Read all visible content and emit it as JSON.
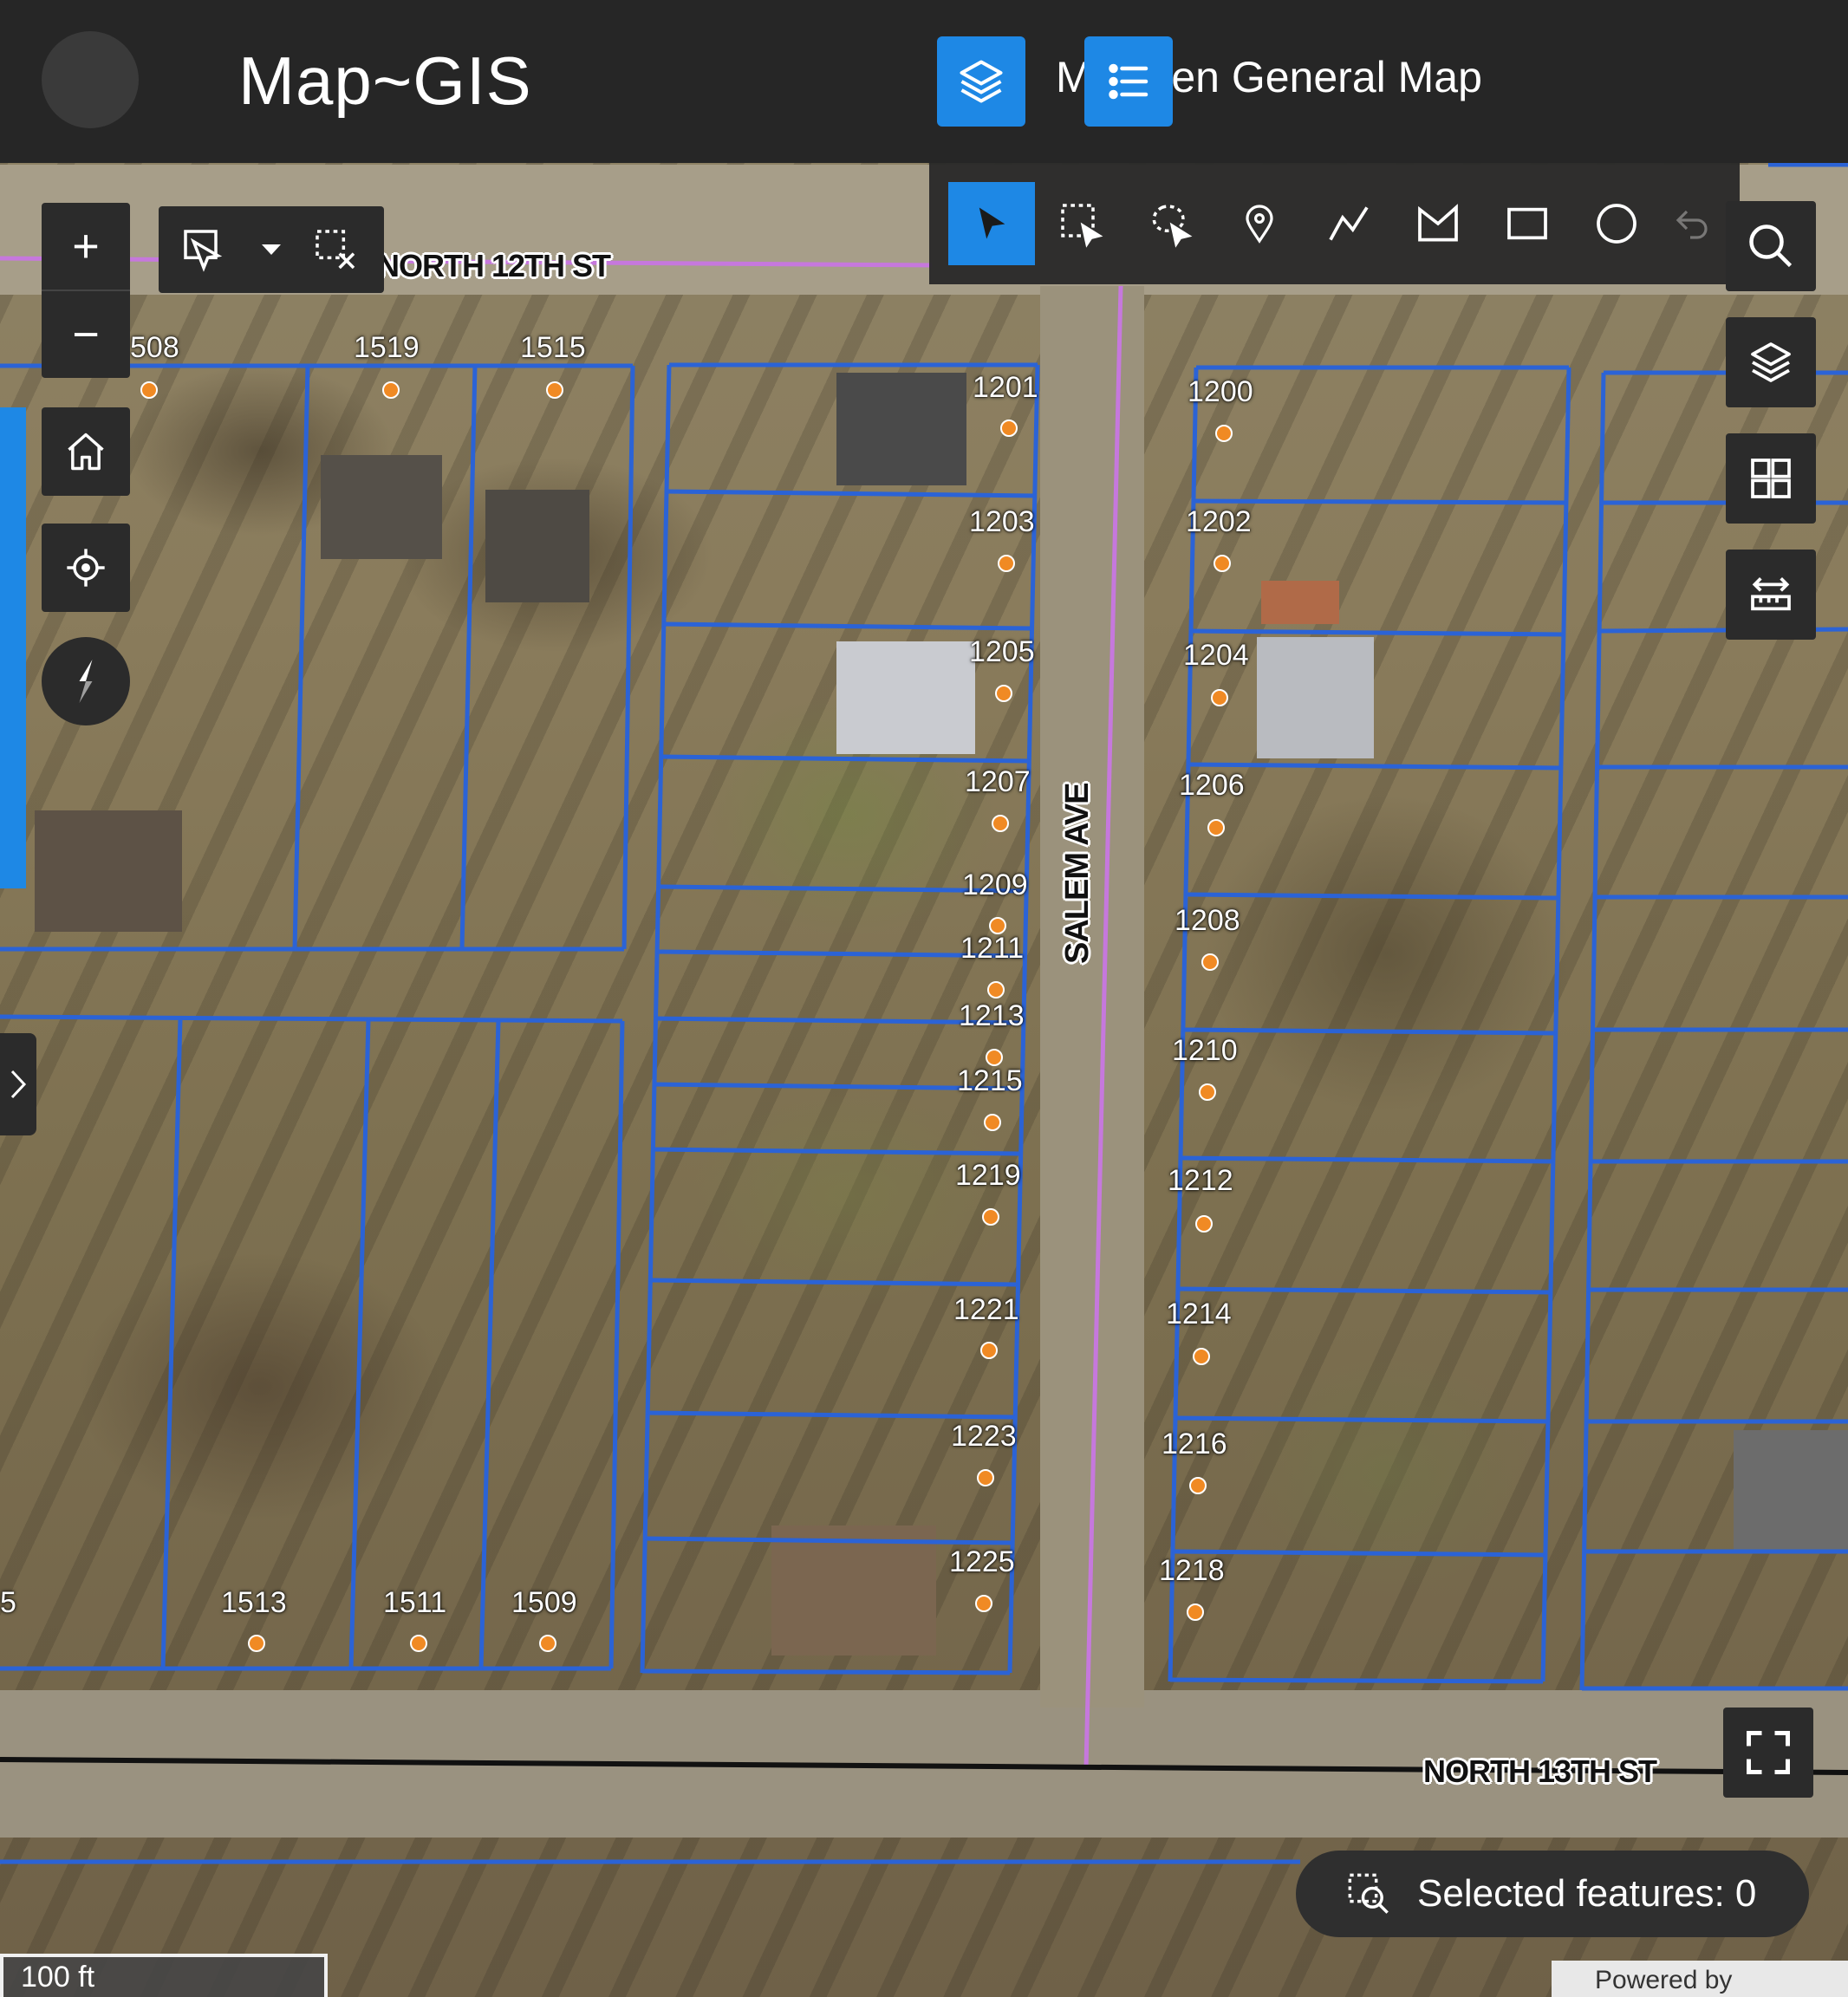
{
  "header": {
    "app_title": "Map~GIS",
    "map_title": "M    acken General Map"
  },
  "icons": {
    "layers": "layers-icon",
    "legend": "legend-list-icon",
    "select": "pointer-icon",
    "rect_select": "rectangle-select-icon",
    "lasso_select": "lasso-select-icon",
    "point": "map-pin-icon",
    "polyline": "polyline-icon",
    "polygon": "polygon-icon",
    "rectangle": "rectangle-icon",
    "circle": "circle-icon",
    "undo": "undo-icon",
    "search": "search-icon",
    "basemap": "basemap-gallery-icon",
    "measure": "measure-icon",
    "home": "home-icon",
    "locate": "locate-icon",
    "compass": "compass-icon",
    "fullscreen": "fullscreen-icon"
  },
  "colors": {
    "accent": "#1e88e5",
    "parcel_line": "#2b63d6",
    "road_line": "#c678dd",
    "point": "#f08a24",
    "toolbar": "#262626"
  },
  "controls": {
    "zoom_in": "+",
    "zoom_out": "−"
  },
  "streets": {
    "north_12th": "NORTH 12TH ST",
    "north_13th": "NORTH 13TH ST",
    "salem": "SALEM AVE"
  },
  "parcels": {
    "top_left": [
      "508",
      "1519",
      "1515"
    ],
    "west_col": [
      "1201",
      "1203",
      "1205",
      "1207",
      "1209",
      "1211",
      "1213",
      "1215",
      "1219",
      "1221",
      "1223",
      "1225"
    ],
    "east_col": [
      "1200",
      "1202",
      "1204",
      "1206",
      "1208",
      "1210",
      "1212",
      "1214",
      "1216",
      "1218"
    ],
    "bottom_left": [
      "5",
      "1513",
      "1511",
      "1509"
    ]
  },
  "status": {
    "selected_features": "Selected features: 0",
    "scale": "100 ft",
    "powered_by": "Powered by"
  }
}
